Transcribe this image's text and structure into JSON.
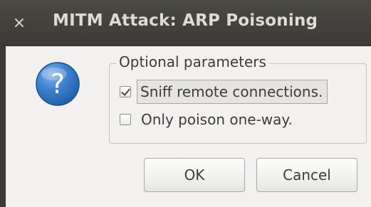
{
  "window": {
    "title": "MITM Attack: ARP Poisoning",
    "close_glyph": "×"
  },
  "icon": {
    "name": "question-icon",
    "glyph": "?"
  },
  "options": {
    "legend": "Optional parameters",
    "items": [
      {
        "label": "Sniff remote connections.",
        "checked": true,
        "focused": true
      },
      {
        "label": "Only poison one-way.",
        "checked": false,
        "focused": false
      }
    ]
  },
  "buttons": {
    "ok_label": "OK",
    "cancel_label": "Cancel"
  },
  "colors": {
    "titlebar": "#3c3b37",
    "title_text": "#dfdbd2",
    "background": "#f2f1f0",
    "icon_blue": "#2f6db3",
    "text": "#3c3c3c"
  }
}
